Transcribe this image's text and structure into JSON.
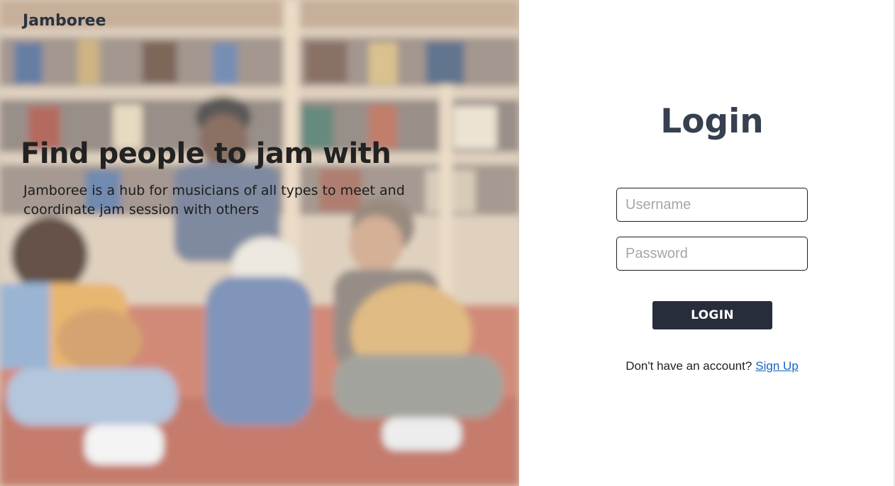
{
  "brand": {
    "name": "Jamboree"
  },
  "hero": {
    "headline": "Find people to jam with",
    "description": "Jamboree is a hub for musicians of all types to meet and coordinate jam session with others",
    "background_image": "blurred-photo-of-musicians-jamming-in-front-of-bookshelves"
  },
  "login": {
    "title": "Login",
    "username_placeholder": "Username",
    "username_value": "",
    "password_placeholder": "Password",
    "password_value": "",
    "submit_label": "LOGIN",
    "signup_prompt": "Don't have an account?",
    "signup_link": "Sign Up"
  },
  "colors": {
    "title_text": "#36404f",
    "button_background": "#272d3a",
    "button_text": "#ffffff",
    "link": "#1565c0"
  }
}
